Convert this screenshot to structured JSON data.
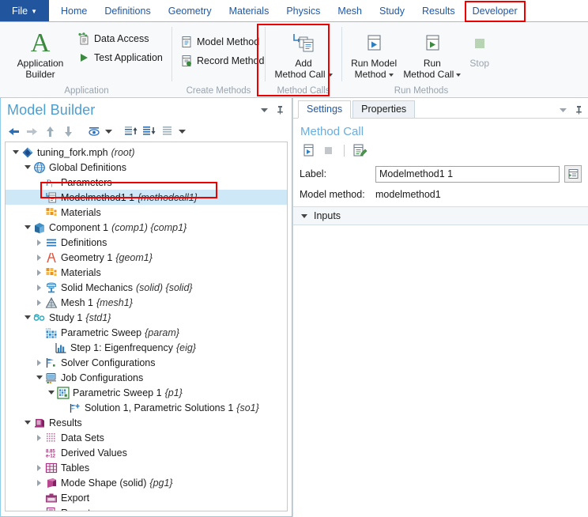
{
  "ribbon": {
    "file_tab": "File",
    "tabs": [
      {
        "label": "Home"
      },
      {
        "label": "Definitions"
      },
      {
        "label": "Geometry"
      },
      {
        "label": "Materials"
      },
      {
        "label": "Physics"
      },
      {
        "label": "Mesh"
      },
      {
        "label": "Study"
      },
      {
        "label": "Results"
      },
      {
        "label": "Developer"
      }
    ],
    "groups": [
      {
        "title": "Application",
        "big": {
          "label_line1": "Application",
          "label_line2": "Builder",
          "icon": "letter-a-icon"
        },
        "small": [
          {
            "label": "Data Access",
            "icon": "data-access-icon"
          },
          {
            "label": "Test Application",
            "icon": "play-triangle-icon"
          }
        ]
      },
      {
        "title": "Create Methods",
        "small": [
          {
            "label": "Model Method",
            "icon": "model-method-icon"
          },
          {
            "label": "Record Method",
            "icon": "record-method-icon"
          }
        ]
      },
      {
        "title": "Method Calls",
        "big": {
          "label_line1": "Add",
          "label_line2": "Method Call",
          "icon": "add-method-call-icon",
          "has_caret": true
        }
      },
      {
        "title": "Run Methods",
        "buttons": [
          {
            "label_line1": "Run Model",
            "label_line2": "Method",
            "icon": "run-model-method-icon",
            "has_caret": true
          },
          {
            "label_line1": "Run",
            "label_line2": "Method Call",
            "icon": "run-method-call-icon",
            "has_caret": true
          },
          {
            "label_line1": "Stop",
            "label_line2": "",
            "icon": "stop-icon",
            "disabled": true
          }
        ]
      }
    ]
  },
  "model_builder": {
    "title": "Model Builder",
    "toolbar": [
      {
        "name": "back-arrow-icon"
      },
      {
        "name": "forward-arrow-icon"
      },
      {
        "name": "up-arrow-icon"
      },
      {
        "name": "down-arrow-icon"
      },
      {
        "name": "show-eye-icon"
      },
      {
        "name": "show-dropdown-caret-icon"
      },
      {
        "name": "collapse-up-icon"
      },
      {
        "name": "expand-down-icon"
      },
      {
        "name": "list-icon"
      },
      {
        "name": "list-dropdown-caret-icon"
      }
    ],
    "tree": [
      {
        "depth": 0,
        "twist": "open",
        "icon": "root-diamond-icon",
        "label": "tuning_fork.mph",
        "tag": "(root)"
      },
      {
        "depth": 1,
        "twist": "open",
        "icon": "globe-icon",
        "label": "Global Definitions",
        "tag": ""
      },
      {
        "depth": 2,
        "twist": "none",
        "icon": "parameters-pi-icon",
        "label": "Parameters",
        "tag": ""
      },
      {
        "depth": 2,
        "twist": "none",
        "icon": "method-call-icon",
        "label": "Modelmethod1 1",
        "tag": "{methodcall1}",
        "selected": true,
        "highlighted": true
      },
      {
        "depth": 2,
        "twist": "none",
        "icon": "materials-icon",
        "label": "Materials",
        "tag": ""
      },
      {
        "depth": 1,
        "twist": "open",
        "icon": "component-box-icon",
        "label": "Component 1",
        "tag": "(comp1) {comp1}"
      },
      {
        "depth": 2,
        "twist": "closed",
        "icon": "definitions-lines-icon",
        "label": "Definitions",
        "tag": ""
      },
      {
        "depth": 2,
        "twist": "closed",
        "icon": "geometry-icon",
        "label": "Geometry 1",
        "tag": "{geom1}"
      },
      {
        "depth": 2,
        "twist": "closed",
        "icon": "materials-icon",
        "label": "Materials",
        "tag": ""
      },
      {
        "depth": 2,
        "twist": "closed",
        "icon": "solid-mechanics-icon",
        "label": "Solid Mechanics",
        "tag": "(solid) {solid}"
      },
      {
        "depth": 2,
        "twist": "closed",
        "icon": "mesh-triangle-icon",
        "label": "Mesh 1",
        "tag": "{mesh1}"
      },
      {
        "depth": 1,
        "twist": "open",
        "icon": "study-icon",
        "label": "Study 1",
        "tag": "{std1}"
      },
      {
        "depth": 2,
        "twist": "none",
        "icon": "parametric-sweep-icon",
        "label": "Parametric Sweep",
        "tag": "{param}"
      },
      {
        "depth": 2,
        "twist": "none",
        "icon": "eigenfrequency-icon",
        "label": "Step 1: Eigenfrequency",
        "tag": "{eig}",
        "extra_indent": true
      },
      {
        "depth": 2,
        "twist": "closed",
        "icon": "solver-config-icon",
        "label": "Solver Configurations",
        "tag": ""
      },
      {
        "depth": 2,
        "twist": "open",
        "icon": "job-config-icon",
        "label": "Job Configurations",
        "tag": ""
      },
      {
        "depth": 3,
        "twist": "open",
        "icon": "parametric-sweep-job-icon",
        "label": "Parametric Sweep 1",
        "tag": "{p1}"
      },
      {
        "depth": 4,
        "twist": "none",
        "icon": "solution-icon",
        "label": "Solution 1, Parametric Solutions 1",
        "tag": "{so1}"
      },
      {
        "depth": 1,
        "twist": "open",
        "icon": "results-icon",
        "label": "Results",
        "tag": ""
      },
      {
        "depth": 2,
        "twist": "closed",
        "icon": "data-sets-icon",
        "label": "Data Sets",
        "tag": ""
      },
      {
        "depth": 2,
        "twist": "none",
        "icon": "derived-values-icon",
        "label": "Derived Values",
        "tag": ""
      },
      {
        "depth": 2,
        "twist": "closed",
        "icon": "tables-icon",
        "label": "Tables",
        "tag": ""
      },
      {
        "depth": 2,
        "twist": "closed",
        "icon": "plot-group-icon",
        "label": "Mode Shape (solid)",
        "tag": "{pg1}"
      },
      {
        "depth": 2,
        "twist": "none",
        "icon": "export-icon",
        "label": "Export",
        "tag": ""
      },
      {
        "depth": 2,
        "twist": "none",
        "icon": "reports-icon",
        "label": "Reports",
        "tag": ""
      }
    ]
  },
  "settings": {
    "tabs": [
      {
        "label": "Settings",
        "active": true
      },
      {
        "label": "Properties",
        "active": false
      }
    ],
    "heading": "Method Call",
    "toolbar": [
      {
        "name": "run-method-call-icon"
      },
      {
        "name": "stop-square-icon"
      },
      {
        "name": "edit-method-icon"
      }
    ],
    "label_field": {
      "label": "Label:",
      "value": "Modelmethod1 1",
      "button_icon": "rename-icon"
    },
    "model_method": {
      "label": "Model method:",
      "value": "modelmethod1"
    },
    "sections": [
      {
        "label": "Inputs",
        "expanded": true
      }
    ]
  },
  "colors": {
    "ribbon_blue": "#1d59a8",
    "highlight_red": "#ee0000",
    "selection_blue": "#cfe8f7",
    "panel_title_blue": "#4a9fd4",
    "green_accent": "#3c8a3f"
  }
}
